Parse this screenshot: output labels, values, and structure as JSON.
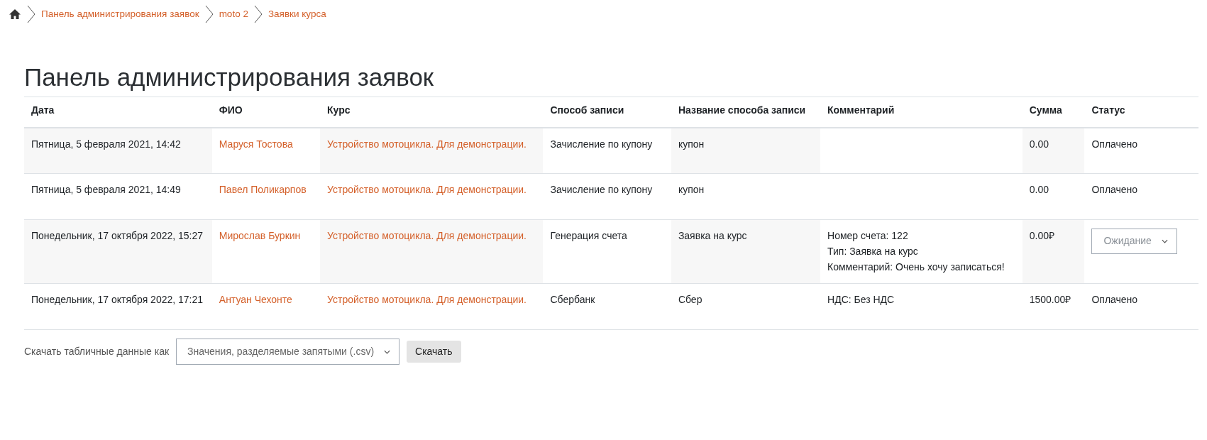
{
  "breadcrumb": [
    {
      "label": "Панель администрирования заявок"
    },
    {
      "label": "moto 2"
    },
    {
      "label": "Заявки курса"
    }
  ],
  "page_title": "Панель администрирования заявок",
  "table": {
    "columns": [
      "Дата",
      "ФИО",
      "Курс",
      "Способ записи",
      "Название способа записи",
      "Комментарий",
      "Сумма",
      "Статус"
    ],
    "rows": [
      {
        "date": "Пятница, 5 февраля 2021, 14:42",
        "name": "Маруся Тостова",
        "course": "Устройство мотоцикла. Для демонстрации.",
        "method": "Зачисление по купону",
        "method_name": "купон",
        "comment": [],
        "sum": "0.00",
        "status": {
          "kind": "text",
          "label": "Оплачено"
        }
      },
      {
        "date": "Пятница, 5 февраля 2021, 14:49",
        "name": "Павел Поликарпов",
        "course": "Устройство мотоцикла. Для демонстрации.",
        "method": "Зачисление по купону",
        "method_name": "купон",
        "comment": [],
        "sum": "0.00",
        "status": {
          "kind": "text",
          "label": "Оплачено"
        }
      },
      {
        "date": "Понедельник, 17 октября 2022, 15:27",
        "name": "Мирослав Буркин",
        "course": "Устройство мотоцикла. Для демонстрации.",
        "method": "Генерация счета",
        "method_name": "Заявка на курс",
        "comment": [
          "Номер счета: 122",
          "Тип: Заявка на курс",
          "Комментарий: Очень хочу записаться!"
        ],
        "sum": "0.00₽",
        "status": {
          "kind": "select",
          "label": "Ожидание"
        }
      },
      {
        "date": "Понедельник, 17 октября 2022, 17:21",
        "name": "Антуан Чехонте",
        "course": "Устройство мотоцикла. Для демонстрации.",
        "method": "Сбербанк",
        "method_name": "Сбер",
        "comment": [
          "НДС: Без НДС"
        ],
        "sum": "1500.00₽",
        "status": {
          "kind": "text",
          "label": "Оплачено"
        }
      }
    ]
  },
  "download": {
    "label": "Скачать табличные данные как",
    "format": "Значения, разделяемые запятыми (.csv)",
    "button": "Скачать"
  }
}
